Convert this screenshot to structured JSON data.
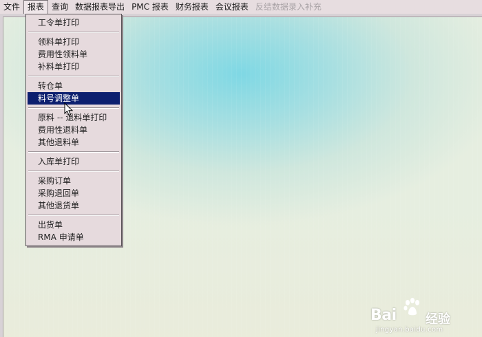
{
  "menubar": {
    "items": [
      {
        "label": "文件",
        "state": "normal"
      },
      {
        "label": "报表",
        "state": "active"
      },
      {
        "label": "查询",
        "state": "normal"
      },
      {
        "label": "数据报表导出",
        "state": "normal"
      },
      {
        "label": "PMC 报表",
        "state": "normal"
      },
      {
        "label": "财务报表",
        "state": "normal"
      },
      {
        "label": "会议报表",
        "state": "normal"
      },
      {
        "label": "反结数据录入补充",
        "state": "disabled"
      }
    ]
  },
  "dropdown": {
    "groups": [
      [
        "工令单打印"
      ],
      [
        "领料单打印",
        "费用性领料单",
        "补料单打印"
      ],
      [
        "转仓单",
        "料号调整单"
      ],
      [
        "原料 -- 退料单打印",
        "费用性退料单",
        "其他退料单"
      ],
      [
        "入库单打印"
      ],
      [
        "采购订单",
        "采购退回单",
        "其他退货单"
      ],
      [
        "出货单",
        "RMA 申请单"
      ]
    ],
    "selected": "料号调整单"
  },
  "watermark": {
    "brand_left": "Bai",
    "brand_right": "经验",
    "url": "jingyan.baidu.com"
  },
  "colors": {
    "menubar_bg": "#e7dde0",
    "menu_bg": "#e6dadd",
    "selection": "#0c1f6f"
  }
}
